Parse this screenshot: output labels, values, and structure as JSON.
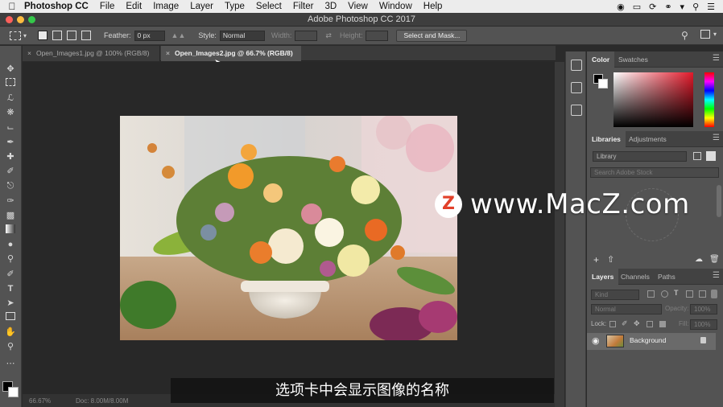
{
  "menubar": {
    "app": "Photoshop CC",
    "items": [
      "File",
      "Edit",
      "Image",
      "Layer",
      "Type",
      "Select",
      "Filter",
      "3D",
      "View",
      "Window",
      "Help"
    ]
  },
  "window": {
    "title": "Adobe Photoshop CC 2017"
  },
  "options": {
    "feather_label": "Feather:",
    "feather_value": "0 px",
    "style_label": "Style:",
    "style_value": "Normal",
    "width_label": "Width:",
    "height_label": "Height:",
    "select_mask": "Select and Mask..."
  },
  "tabs": [
    {
      "label": "Open_Images1.jpg @ 100% (RGB/8)",
      "active": false
    },
    {
      "label": "Open_Images2.jpg @ 66.7% (RGB/8)",
      "active": true
    }
  ],
  "status": {
    "zoom": "66.67%",
    "doc": "Doc: 8.00M/8.00M"
  },
  "panels": {
    "color_tabs": [
      "Color",
      "Swatches"
    ],
    "library_tabs": [
      "Libraries",
      "Adjustments"
    ],
    "library_select": "Library",
    "library_search": "Search Adobe Stock",
    "layer_tabs": [
      "Layers",
      "Channels",
      "Paths"
    ],
    "layer_kind": "Kind",
    "blend_mode": "Normal",
    "opacity_label": "Opacity:",
    "opacity_value": "100%",
    "lock_label": "Lock:",
    "fill_label": "Fill:",
    "fill_value": "100%",
    "layer_name": "Background"
  },
  "watermark": {
    "logo": "Z",
    "text": "www.MacZ.com"
  },
  "subtitle": "选项卡中会显示图像的名称",
  "colors": {
    "accent_red": "#e2402a",
    "panel": "#535353",
    "canvas": "#282828"
  }
}
